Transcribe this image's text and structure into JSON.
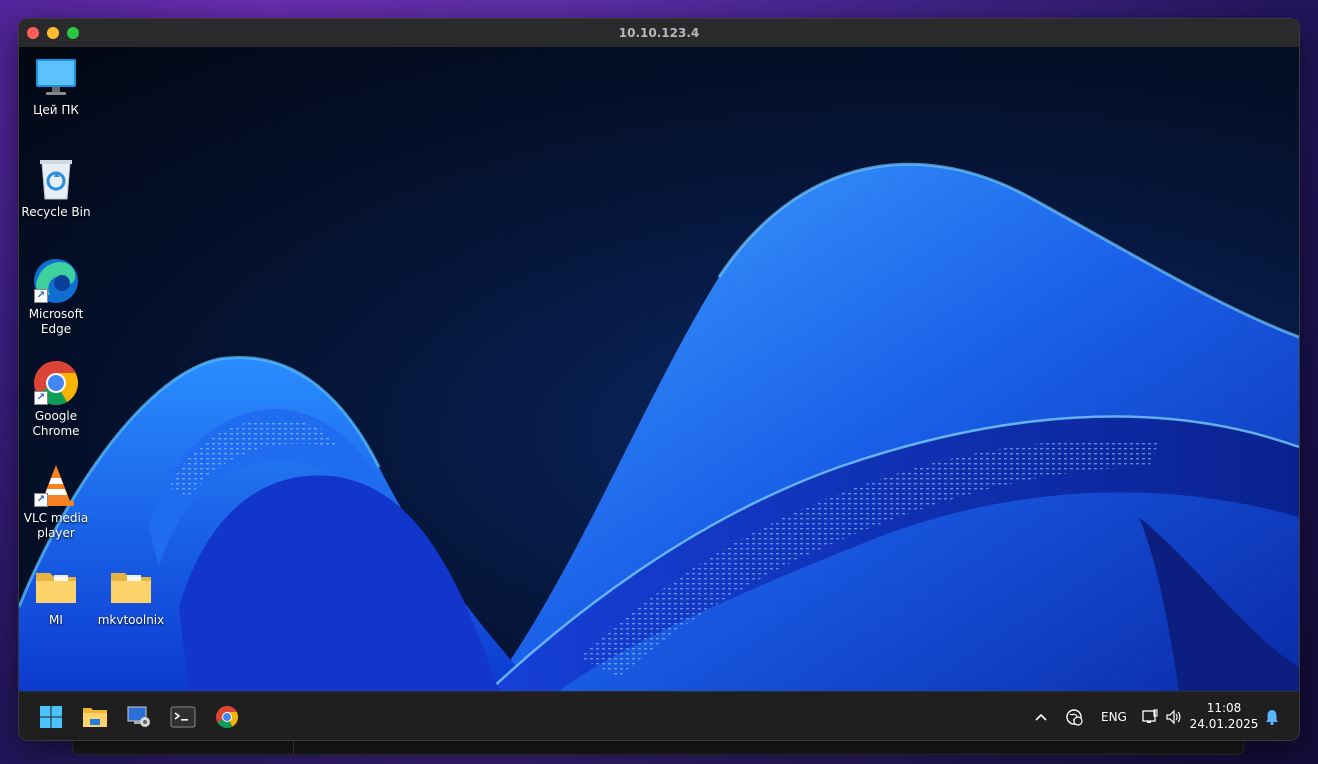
{
  "window": {
    "title": "10.10.123.4"
  },
  "desktop_icons": [
    {
      "name": "this-pc",
      "label": "Цей ПК"
    },
    {
      "name": "recycle-bin",
      "label": "Recycle Bin"
    },
    {
      "name": "microsoft-edge",
      "label": "Microsoft Edge"
    },
    {
      "name": "google-chrome",
      "label": "Google Chrome"
    },
    {
      "name": "vlc",
      "label": "VLC media player"
    },
    {
      "name": "folder-mi",
      "label": "MI"
    },
    {
      "name": "folder-mkvtoolnix",
      "label": "mkvtoolnix"
    }
  ],
  "taskbar": {
    "apps": [
      "windows-start-icon",
      "file-explorer-icon",
      "remote-desktop-icon",
      "terminal-icon",
      "chrome-icon"
    ],
    "tray": {
      "language": "ENG",
      "time": "11:08",
      "date": "24.01.2025"
    }
  },
  "colors": {
    "accent": "#2f7bff",
    "taskbar": "#1f1f1f"
  }
}
